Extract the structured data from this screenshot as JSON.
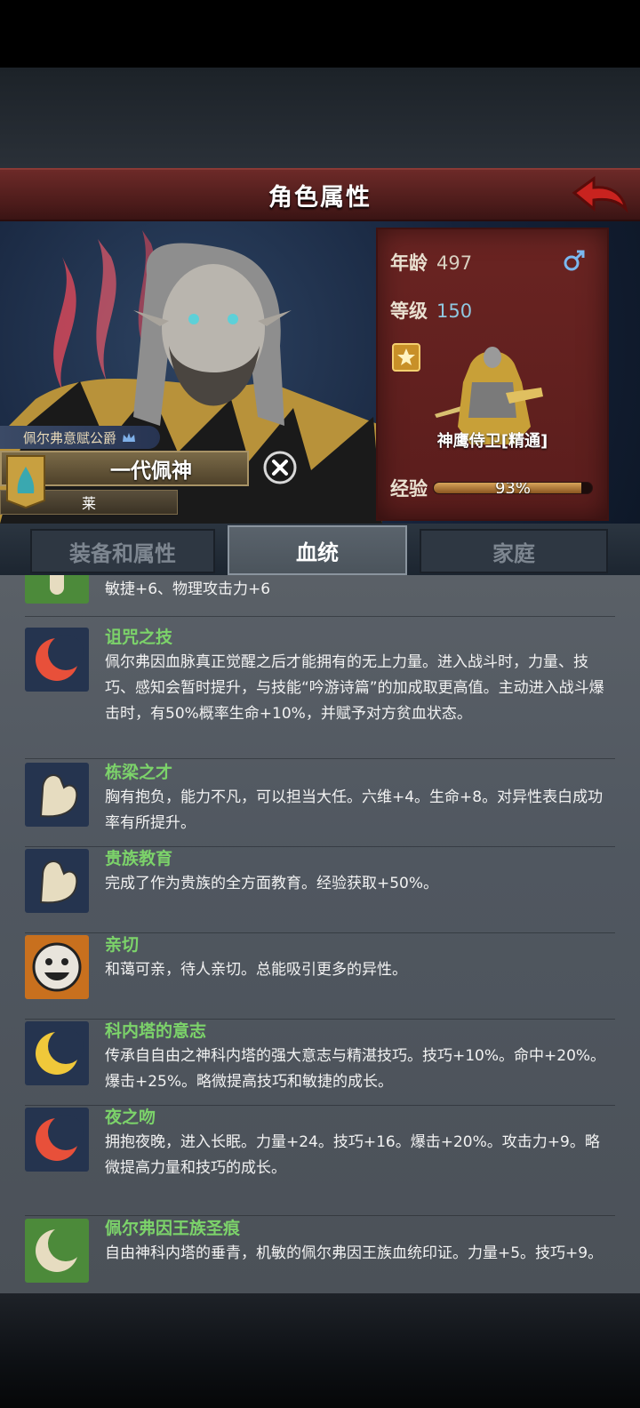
{
  "header": {
    "title": "角色属性"
  },
  "character": {
    "honor_title": "佩尔弗意赋公爵",
    "name": "一代佩神",
    "family": "莱"
  },
  "stats": {
    "age_label": "年龄",
    "age_value": "497",
    "level_label": "等级",
    "level_value": "150",
    "unit_name": "神鹰侍卫[精通]",
    "exp_label": "经验",
    "exp_value": "93%",
    "exp_fraction": 0.93
  },
  "tabs": [
    {
      "label": "装备和属性",
      "active": false
    },
    {
      "label": "血统",
      "active": true
    },
    {
      "label": "家庭",
      "active": false
    }
  ],
  "traits": [
    {
      "name": "",
      "desc": "敏捷+6、物理攻击力+6",
      "icon": "bone-icon"
    },
    {
      "name": "诅咒之技",
      "desc": "佩尔弗因血脉真正觉醒之后才能拥有的无上力量。进入战斗时，力量、技巧、感知会暂时提升，与技能“吟游诗篇”的加成取更高值。主动进入战斗爆击时，有50%概率生命+10%，并赋予对方贫血状态。",
      "icon": "red-moon-icon"
    },
    {
      "name": "栋梁之才",
      "desc": "胸有抱负，能力不凡，可以担当大任。六维+4。生命+8。对异性表白成功率有所提升。",
      "icon": "muscle-arm-icon"
    },
    {
      "name": "贵族教育",
      "desc": "完成了作为贵族的全方面教育。经验获取+50%。",
      "icon": "muscle-arm-icon"
    },
    {
      "name": "亲切",
      "desc": "和蔼可亲，待人亲切。总能吸引更多的异性。",
      "icon": "smiley-face-icon"
    },
    {
      "name": "科内塔的意志",
      "desc": "传承自自由之神科内塔的强大意志与精湛技巧。技巧+10%。命中+20%。爆击+25%。略微提高技巧和敏捷的成长。",
      "icon": "gold-moon-icon"
    },
    {
      "name": "夜之吻",
      "desc": "拥抱夜晚，进入长眠。力量+24。技巧+16。爆击+20%。攻击力+9。略微提高力量和技巧的成长。",
      "icon": "red-moon-icon"
    },
    {
      "name": "佩尔弗因王族圣痕",
      "desc": "自由神科内塔的垂青，机敏的佩尔弗因王族血统印证。力量+5。技巧+9。",
      "icon": "white-moon-icon"
    }
  ]
}
